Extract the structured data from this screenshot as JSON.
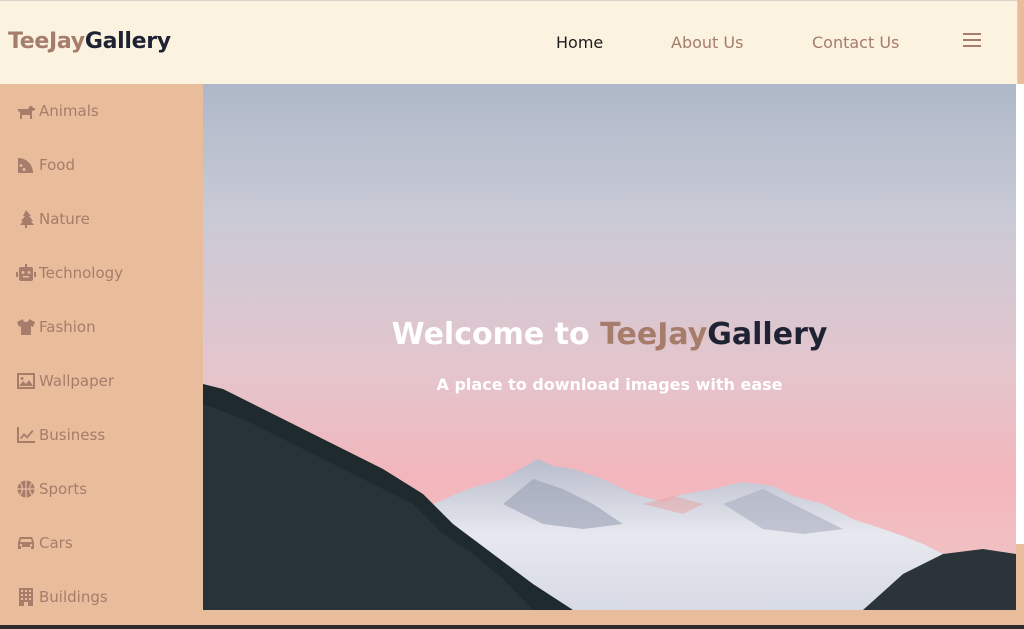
{
  "brand": {
    "part1": "TeeJay",
    "part2": "Gallery"
  },
  "nav": {
    "home": "Home",
    "about": "About Us",
    "contact": "Contact Us"
  },
  "sidebar": {
    "items": [
      {
        "label": "Animals",
        "icon": "dog-icon"
      },
      {
        "label": "Food",
        "icon": "pizza-icon"
      },
      {
        "label": "Nature",
        "icon": "tree-icon"
      },
      {
        "label": "Technology",
        "icon": "robot-icon"
      },
      {
        "label": "Fashion",
        "icon": "tshirt-icon"
      },
      {
        "label": "Wallpaper",
        "icon": "image-icon"
      },
      {
        "label": "Business",
        "icon": "line-chart-icon"
      },
      {
        "label": "Sports",
        "icon": "basketball-icon"
      },
      {
        "label": "Cars",
        "icon": "car-icon"
      },
      {
        "label": "Buildings",
        "icon": "building-icon"
      }
    ]
  },
  "hero": {
    "title_prefix": "Welcome to ",
    "title_brand1": "TeeJay",
    "title_brand2": "Gallery",
    "subtitle": "A place to download images with ease"
  },
  "colors": {
    "accent": "#a67c6a",
    "dark": "#1f2233",
    "header_bg": "#fbf2e0",
    "sidebar_bg": "#e9bd9c"
  }
}
